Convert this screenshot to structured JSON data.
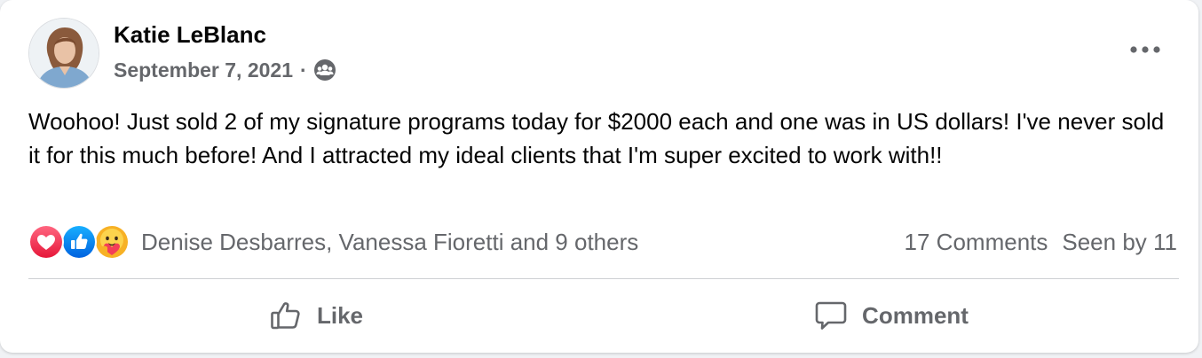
{
  "post": {
    "author": "Katie LeBlanc",
    "date": "September 7, 2021",
    "separator": "·",
    "audience_icon": "group-icon",
    "text": "Woohoo! Just sold 2 of my signature programs today for $2000 each and one was in US dollars! I've never sold it for this much before! And I attracted my ideal clients that I'm super excited to work with!!"
  },
  "reactions": {
    "icons": [
      "love-reaction-icon",
      "like-reaction-icon",
      "care-reaction-icon"
    ],
    "names": "Denise Desbarres, Vanessa Fioretti and 9 others",
    "comments": "17 Comments",
    "seen": "Seen by 11"
  },
  "actions": {
    "like": "Like",
    "comment": "Comment"
  },
  "colors": {
    "love": "#f33e58",
    "like": "#1877f2",
    "care": "#f7b125",
    "secondary_text": "#65676b",
    "primary_text": "#050505"
  }
}
